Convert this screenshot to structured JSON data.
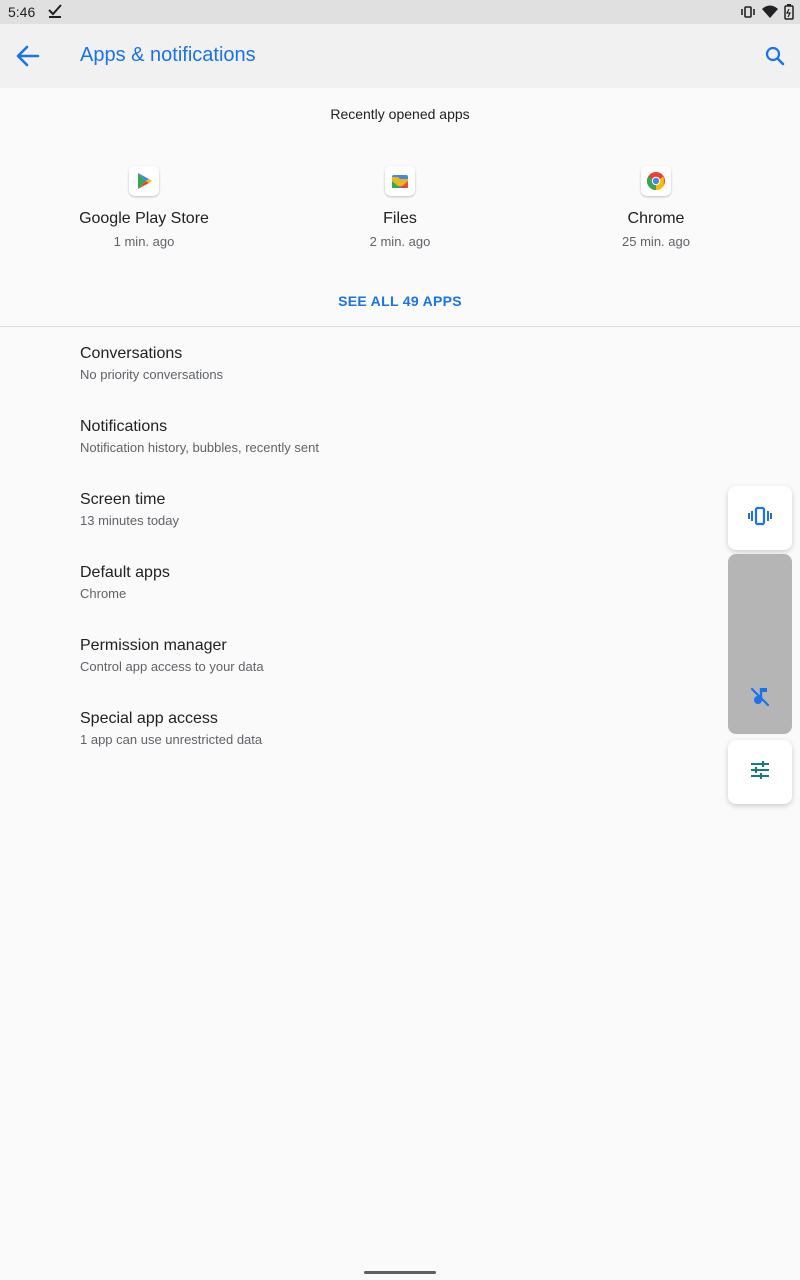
{
  "status_bar": {
    "time": "5:46",
    "icons": [
      "check-icon",
      "vibrate-icon",
      "wifi-icon",
      "battery-icon"
    ]
  },
  "app_bar": {
    "title": "Apps & notifications",
    "back_icon": "arrow-back-icon",
    "search_icon": "search-icon",
    "accent_color": "#1a73e8"
  },
  "recent": {
    "heading": "Recently opened apps",
    "apps": [
      {
        "name": "Google Play Store",
        "time": "1 min. ago",
        "icon": "play-store-icon"
      },
      {
        "name": "Files",
        "time": "2 min. ago",
        "icon": "files-icon"
      },
      {
        "name": "Chrome",
        "time": "25 min. ago",
        "icon": "chrome-icon"
      }
    ],
    "see_all": "SEE ALL 49 APPS"
  },
  "menu": [
    {
      "label": "Conversations",
      "summary": "No priority conversations"
    },
    {
      "label": "Notifications",
      "summary": "Notification history, bubbles, recently sent"
    },
    {
      "label": "Screen time",
      "summary": "13 minutes today"
    },
    {
      "label": "Default apps",
      "summary": "Chrome"
    },
    {
      "label": "Permission manager",
      "summary": "Control app access to your data"
    },
    {
      "label": "Special app access",
      "summary": "1 app can use unrestricted data"
    }
  ],
  "volume_panel": {
    "ringer_icon": "vibrate-icon",
    "media_icon": "music-off-icon",
    "settings_icon": "tune-icon",
    "level": 0
  }
}
